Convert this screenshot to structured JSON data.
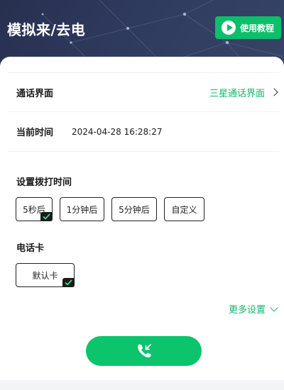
{
  "header": {
    "title": "模拟来/去电",
    "tutorial_label": "使用教程"
  },
  "call_ui": {
    "label": "通话界面",
    "value": "三星通话界面"
  },
  "current_time": {
    "label": "当前时间",
    "value": "2024-04-28 16:28:27"
  },
  "dial_time": {
    "label": "设置拨打时间",
    "options": [
      "5秒后",
      "1分钟后",
      "5分钟后",
      "自定义"
    ],
    "selected": "5秒后"
  },
  "sim_card": {
    "label": "电话卡",
    "options": [
      "默认卡"
    ],
    "selected": "默认卡"
  },
  "more_settings": "更多设置",
  "colors": {
    "accent": "#0bc46c",
    "header_bg": "#2f3a5f"
  },
  "icons": [
    "play-icon",
    "chevron-right-icon",
    "check-icon",
    "chevron-down-icon",
    "phone-call-icon"
  ]
}
